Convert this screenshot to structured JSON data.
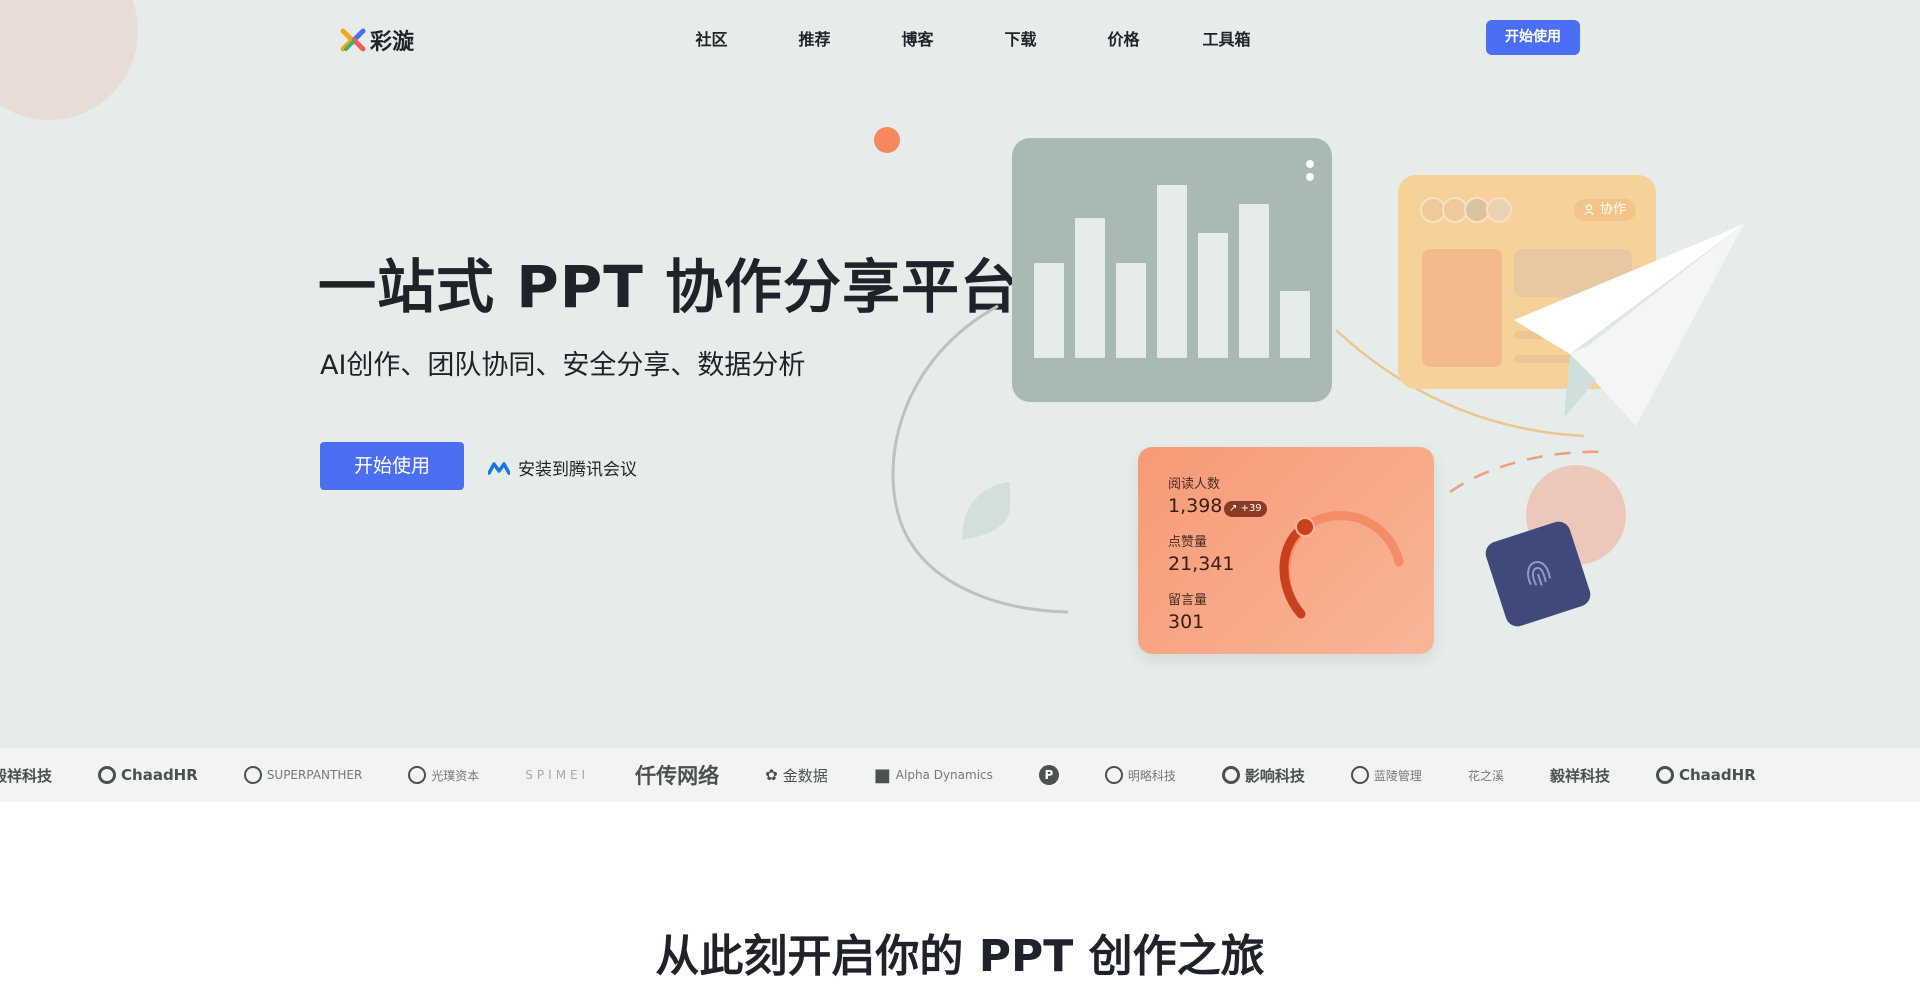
{
  "brand": {
    "name": "彩漩"
  },
  "nav": {
    "items": [
      "社区",
      "推荐",
      "博客",
      "下载",
      "价格",
      "工具箱"
    ],
    "cta": "开始使用"
  },
  "hero": {
    "title": "一站式 PPT 协作分享平台",
    "subtitle": "AI创作、团队协同、安全分享、数据分析",
    "cta": "开始使用",
    "install_link": "安装到腾讯会议"
  },
  "illustration": {
    "collab_badge": "协作",
    "stats": [
      {
        "label": "阅读人数",
        "value": "1,398",
        "badge": "+39"
      },
      {
        "label": "点赞量",
        "value": "21,341"
      },
      {
        "label": "留言量",
        "value": "301"
      }
    ]
  },
  "partners": [
    "毅祥科技",
    "ChaadHR",
    "SUPERPANTHER",
    "光璞资本",
    "SPIMEI",
    "仟传网络",
    "金数据",
    "Alpha Dynamics",
    "P",
    "明略科技",
    "影响科技",
    "蓝陵管理",
    "花之溪",
    "毅祥科技",
    "ChaadHR"
  ],
  "next_section": {
    "title": "从此刻开启你的 PPT 创作之旅"
  }
}
